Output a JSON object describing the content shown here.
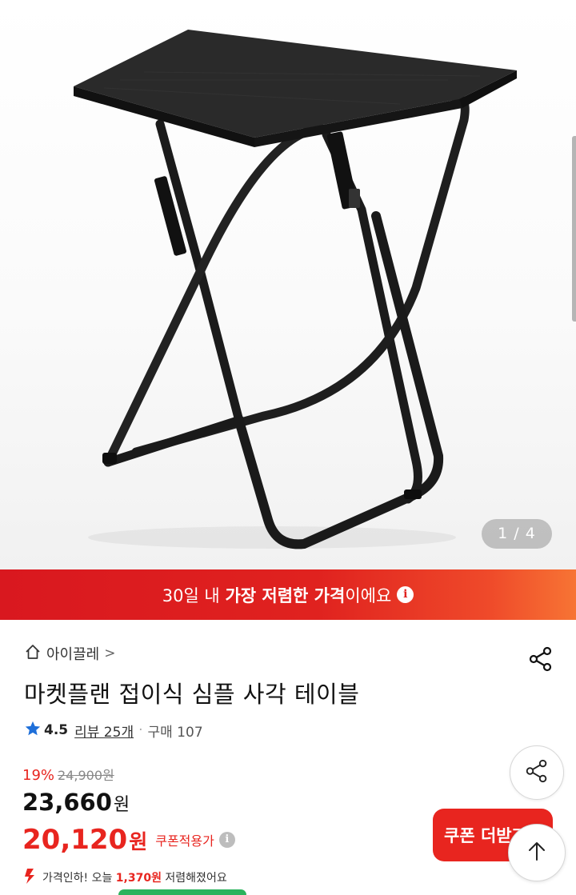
{
  "gallery": {
    "product_image_alt": "folding-table-photo",
    "counter": "1 / 4"
  },
  "banner": {
    "prefix": "30일 내 ",
    "highlight": "가장 저렴한 가격",
    "suffix": "이에요",
    "info_icon": "i"
  },
  "store": {
    "name": "아이끌레",
    "chevron": ">"
  },
  "product": {
    "title": "마켓플랜 접이식 심플 사각 테이블",
    "rating": "4.5",
    "review_label": "리뷰 25개",
    "separator": "·",
    "purchase_label": "구매 107"
  },
  "pricing": {
    "discount_pct": "19%",
    "original_price": "24,900원",
    "price_value": "23,660",
    "price_unit": "원",
    "coupon_price_value": "20,120",
    "coupon_price_unit": "원",
    "coupon_label": "쿠폰적용가",
    "coupon_info_icon": "i",
    "price_drop_prefix": "가격인하! 오늘 ",
    "price_drop_amount": "1,370원",
    "price_drop_suffix": " 저렴해졌어요"
  },
  "buttons": {
    "coupon_button_label": "쿠폰 더받기"
  },
  "colors": {
    "accent_red": "#e8251f",
    "banner_gradient_end": "#f77434",
    "rating_star": "#1e6fd9",
    "green_pill": "#2ab35c"
  },
  "icons": {
    "home": "home-icon",
    "share": "share-icon",
    "star": "star-icon",
    "info": "info-icon",
    "scroll_top": "arrow-up-icon",
    "price_drop": "down-arrow-icon"
  }
}
